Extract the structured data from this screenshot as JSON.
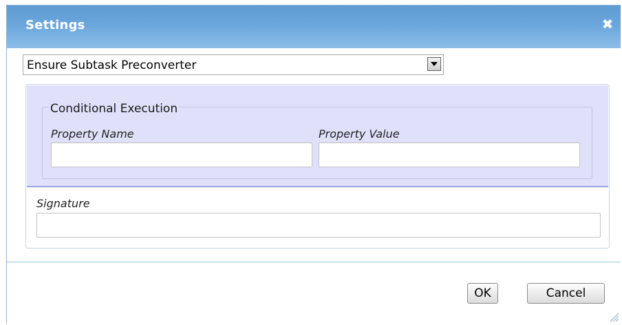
{
  "dialog": {
    "title": "Settings",
    "close_glyph": "✖",
    "close_icon": "close-icon",
    "resize_icon": "resize-grip-icon"
  },
  "type_select": {
    "value": "Ensure Subtask Preconverter"
  },
  "conditional": {
    "legend": "Conditional Execution",
    "property_name_label": "Property Name",
    "property_name_value": "",
    "property_value_label": "Property Value",
    "property_value_value": ""
  },
  "signature": {
    "label": "Signature",
    "value": ""
  },
  "buttons": {
    "ok_label": "OK",
    "cancel_label": "Cancel"
  },
  "colors": {
    "titlebar": "#6aa6dc",
    "conditional_bg": "#e0e0fa",
    "divider": "#9ac0dd"
  }
}
